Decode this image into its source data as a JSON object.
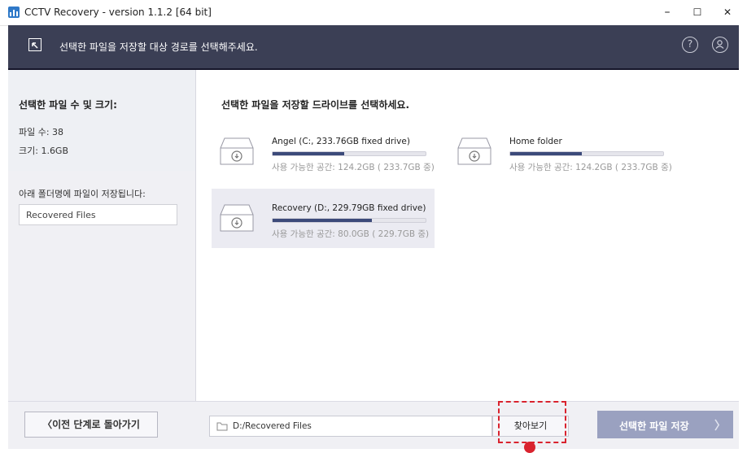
{
  "window": {
    "title": "CCTV Recovery - version 1.1.2 [64 bit]",
    "minimize": "–",
    "maximize": "☐",
    "close": "✕"
  },
  "header": {
    "instruction": "선택한 파일을 저장할 대상 경로를 선택해주세요.",
    "help_icon": "?",
    "account_icon": "person"
  },
  "left_panel": {
    "title": "선택한 파일 수 및 크기:",
    "file_count": "파일 수: 38",
    "size": "크기: 1.6GB",
    "folder_label": "아래 폴더명에 파일이 저장됩니다:",
    "folder_value": "Recovered Files"
  },
  "main": {
    "title": "선택한 파일을 저장할 드라이브를 선택하세요.",
    "drives": [
      {
        "name": "Angel (C:, 233.76GB fixed drive)",
        "space": "사용 가능한 공간: 124.2GB ( 233.7GB 중)",
        "used_fraction": 0.47,
        "selected": false
      },
      {
        "name": "Home folder",
        "space": "사용 가능한 공간: 124.2GB ( 233.7GB 중)",
        "used_fraction": 0.47,
        "selected": false
      },
      {
        "name": "Recovery (D:, 229.79GB fixed drive)",
        "space": "사용 가능한 공간: 80.0GB ( 229.7GB 중)",
        "used_fraction": 0.65,
        "selected": true
      }
    ]
  },
  "bottom": {
    "back_label": "〈이전 단계로 돌아가기",
    "path_value": "D:/Recovered Files",
    "browse_label": "찾아보기",
    "save_label": "선택한 파일 저장",
    "save_arrow": "〉"
  },
  "colors": {
    "header_bg": "#3b3f55",
    "accent": "#3c4a7a",
    "save_button": "#9aa1c0",
    "highlight": "#d9232e"
  }
}
